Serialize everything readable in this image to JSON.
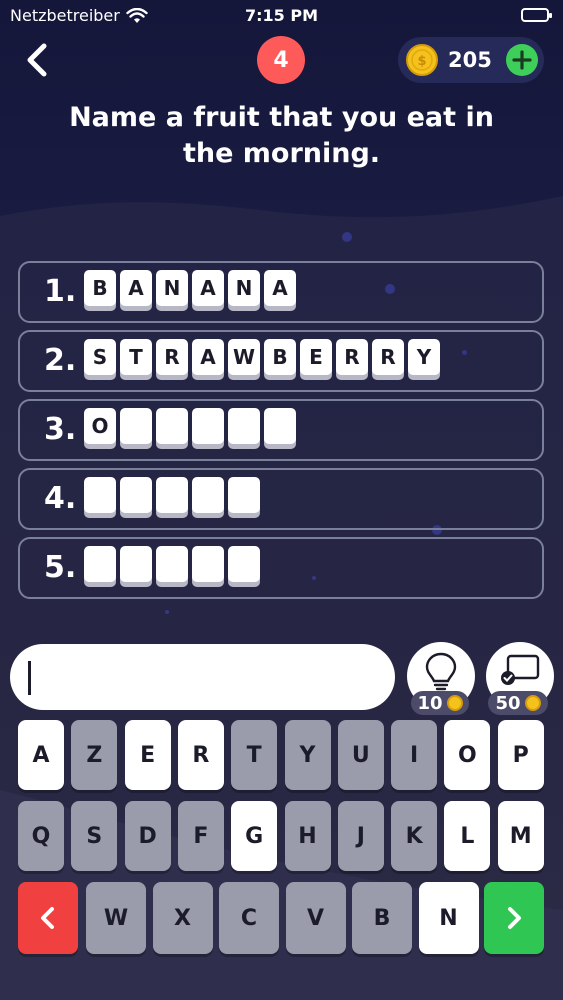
{
  "status": {
    "carrier": "Netzbetreiber",
    "time": "7:15 PM"
  },
  "header": {
    "level": "4",
    "coins": "205"
  },
  "question": "Name a fruit that you eat in the morning.",
  "answers": [
    {
      "num": "1.",
      "letters": [
        "B",
        "A",
        "N",
        "A",
        "N",
        "A"
      ]
    },
    {
      "num": "2.",
      "letters": [
        "S",
        "T",
        "R",
        "A",
        "W",
        "B",
        "E",
        "R",
        "R",
        "Y"
      ]
    },
    {
      "num": "3.",
      "letters": [
        "O",
        "",
        "",
        "",
        "",
        ""
      ]
    },
    {
      "num": "4.",
      "letters": [
        "",
        "",
        "",
        "",
        ""
      ]
    },
    {
      "num": "5.",
      "letters": [
        "",
        "",
        "",
        "",
        ""
      ]
    }
  ],
  "input": {
    "value": ""
  },
  "hints": {
    "reveal_cost": "10",
    "solve_cost": "50"
  },
  "keyboard": {
    "row1": [
      {
        "k": "A",
        "on": true
      },
      {
        "k": "Z",
        "on": false
      },
      {
        "k": "E",
        "on": true
      },
      {
        "k": "R",
        "on": true
      },
      {
        "k": "T",
        "on": false
      },
      {
        "k": "Y",
        "on": false
      },
      {
        "k": "U",
        "on": false
      },
      {
        "k": "I",
        "on": false
      },
      {
        "k": "O",
        "on": true
      },
      {
        "k": "P",
        "on": true
      }
    ],
    "row2": [
      {
        "k": "Q",
        "on": false
      },
      {
        "k": "S",
        "on": false
      },
      {
        "k": "D",
        "on": false
      },
      {
        "k": "F",
        "on": false
      },
      {
        "k": "G",
        "on": true
      },
      {
        "k": "H",
        "on": false
      },
      {
        "k": "J",
        "on": false
      },
      {
        "k": "K",
        "on": false
      },
      {
        "k": "L",
        "on": true
      },
      {
        "k": "M",
        "on": true
      }
    ],
    "row3": [
      {
        "k": "W",
        "on": false
      },
      {
        "k": "X",
        "on": false
      },
      {
        "k": "C",
        "on": false
      },
      {
        "k": "V",
        "on": false
      },
      {
        "k": "B",
        "on": false
      },
      {
        "k": "N",
        "on": true
      }
    ]
  },
  "colors": {
    "badge": "#ff5a5a",
    "plus": "#3ecf5a",
    "delete": "#f04040",
    "submit": "#30c653"
  }
}
